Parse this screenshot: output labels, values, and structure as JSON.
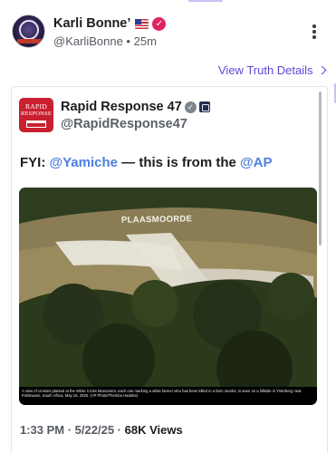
{
  "post": {
    "display_name": "Karli Bonne’",
    "handle": "@KarliBonne",
    "time_ago": "25m",
    "separator": "•",
    "view_truth_details": "View Truth Details"
  },
  "embed": {
    "author_name": "Rapid Response 47",
    "author_handle": "@RapidResponse47",
    "logo_line1": "RAPID",
    "logo_line2": "RESPONSE",
    "text_prefix": "FYI: ",
    "mention1": "@Yamiche",
    "text_middle": " — this is from the ",
    "mention2": "@AP",
    "photo_sign": "PLAASMOORDE",
    "photo_caption": "A view of crosses planted at the White Cross Monument, each one marking a white farmer who has been killed in a farm murder, is seen on a hillside in Ysterberg near Polokwane, South Africa, May 15, 2025. (AP Photo/Themba Hadebe)",
    "timestamp": "1:33 PM · 5/22/25 · ",
    "views": "68K Views"
  },
  "icons": {
    "flag": "us-flag-icon",
    "verified": "verified-badge-icon",
    "more": "more-vertical-icon",
    "chevron": "chevron-right-icon"
  },
  "colors": {
    "accent": "#5b4ad6",
    "mention": "#4d7fe0",
    "verified": "#e0245e",
    "logo_red": "#c8202f"
  }
}
